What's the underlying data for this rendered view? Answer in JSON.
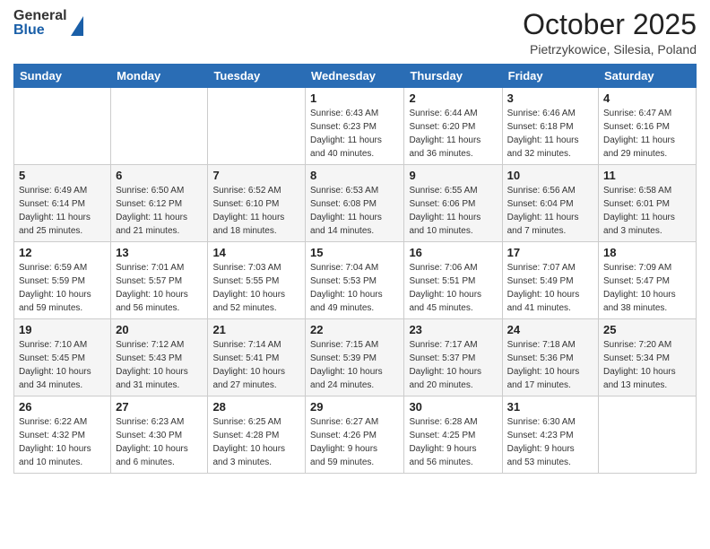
{
  "header": {
    "logo_general": "General",
    "logo_blue": "Blue",
    "month_title": "October 2025",
    "location": "Pietrzykowice, Silesia, Poland"
  },
  "weekdays": [
    "Sunday",
    "Monday",
    "Tuesday",
    "Wednesday",
    "Thursday",
    "Friday",
    "Saturday"
  ],
  "weeks": [
    [
      {
        "day": "",
        "info": ""
      },
      {
        "day": "",
        "info": ""
      },
      {
        "day": "",
        "info": ""
      },
      {
        "day": "1",
        "info": "Sunrise: 6:43 AM\nSunset: 6:23 PM\nDaylight: 11 hours\nand 40 minutes."
      },
      {
        "day": "2",
        "info": "Sunrise: 6:44 AM\nSunset: 6:20 PM\nDaylight: 11 hours\nand 36 minutes."
      },
      {
        "day": "3",
        "info": "Sunrise: 6:46 AM\nSunset: 6:18 PM\nDaylight: 11 hours\nand 32 minutes."
      },
      {
        "day": "4",
        "info": "Sunrise: 6:47 AM\nSunset: 6:16 PM\nDaylight: 11 hours\nand 29 minutes."
      }
    ],
    [
      {
        "day": "5",
        "info": "Sunrise: 6:49 AM\nSunset: 6:14 PM\nDaylight: 11 hours\nand 25 minutes."
      },
      {
        "day": "6",
        "info": "Sunrise: 6:50 AM\nSunset: 6:12 PM\nDaylight: 11 hours\nand 21 minutes."
      },
      {
        "day": "7",
        "info": "Sunrise: 6:52 AM\nSunset: 6:10 PM\nDaylight: 11 hours\nand 18 minutes."
      },
      {
        "day": "8",
        "info": "Sunrise: 6:53 AM\nSunset: 6:08 PM\nDaylight: 11 hours\nand 14 minutes."
      },
      {
        "day": "9",
        "info": "Sunrise: 6:55 AM\nSunset: 6:06 PM\nDaylight: 11 hours\nand 10 minutes."
      },
      {
        "day": "10",
        "info": "Sunrise: 6:56 AM\nSunset: 6:04 PM\nDaylight: 11 hours\nand 7 minutes."
      },
      {
        "day": "11",
        "info": "Sunrise: 6:58 AM\nSunset: 6:01 PM\nDaylight: 11 hours\nand 3 minutes."
      }
    ],
    [
      {
        "day": "12",
        "info": "Sunrise: 6:59 AM\nSunset: 5:59 PM\nDaylight: 10 hours\nand 59 minutes."
      },
      {
        "day": "13",
        "info": "Sunrise: 7:01 AM\nSunset: 5:57 PM\nDaylight: 10 hours\nand 56 minutes."
      },
      {
        "day": "14",
        "info": "Sunrise: 7:03 AM\nSunset: 5:55 PM\nDaylight: 10 hours\nand 52 minutes."
      },
      {
        "day": "15",
        "info": "Sunrise: 7:04 AM\nSunset: 5:53 PM\nDaylight: 10 hours\nand 49 minutes."
      },
      {
        "day": "16",
        "info": "Sunrise: 7:06 AM\nSunset: 5:51 PM\nDaylight: 10 hours\nand 45 minutes."
      },
      {
        "day": "17",
        "info": "Sunrise: 7:07 AM\nSunset: 5:49 PM\nDaylight: 10 hours\nand 41 minutes."
      },
      {
        "day": "18",
        "info": "Sunrise: 7:09 AM\nSunset: 5:47 PM\nDaylight: 10 hours\nand 38 minutes."
      }
    ],
    [
      {
        "day": "19",
        "info": "Sunrise: 7:10 AM\nSunset: 5:45 PM\nDaylight: 10 hours\nand 34 minutes."
      },
      {
        "day": "20",
        "info": "Sunrise: 7:12 AM\nSunset: 5:43 PM\nDaylight: 10 hours\nand 31 minutes."
      },
      {
        "day": "21",
        "info": "Sunrise: 7:14 AM\nSunset: 5:41 PM\nDaylight: 10 hours\nand 27 minutes."
      },
      {
        "day": "22",
        "info": "Sunrise: 7:15 AM\nSunset: 5:39 PM\nDaylight: 10 hours\nand 24 minutes."
      },
      {
        "day": "23",
        "info": "Sunrise: 7:17 AM\nSunset: 5:37 PM\nDaylight: 10 hours\nand 20 minutes."
      },
      {
        "day": "24",
        "info": "Sunrise: 7:18 AM\nSunset: 5:36 PM\nDaylight: 10 hours\nand 17 minutes."
      },
      {
        "day": "25",
        "info": "Sunrise: 7:20 AM\nSunset: 5:34 PM\nDaylight: 10 hours\nand 13 minutes."
      }
    ],
    [
      {
        "day": "26",
        "info": "Sunrise: 6:22 AM\nSunset: 4:32 PM\nDaylight: 10 hours\nand 10 minutes."
      },
      {
        "day": "27",
        "info": "Sunrise: 6:23 AM\nSunset: 4:30 PM\nDaylight: 10 hours\nand 6 minutes."
      },
      {
        "day": "28",
        "info": "Sunrise: 6:25 AM\nSunset: 4:28 PM\nDaylight: 10 hours\nand 3 minutes."
      },
      {
        "day": "29",
        "info": "Sunrise: 6:27 AM\nSunset: 4:26 PM\nDaylight: 9 hours\nand 59 minutes."
      },
      {
        "day": "30",
        "info": "Sunrise: 6:28 AM\nSunset: 4:25 PM\nDaylight: 9 hours\nand 56 minutes."
      },
      {
        "day": "31",
        "info": "Sunrise: 6:30 AM\nSunset: 4:23 PM\nDaylight: 9 hours\nand 53 minutes."
      },
      {
        "day": "",
        "info": ""
      }
    ]
  ]
}
